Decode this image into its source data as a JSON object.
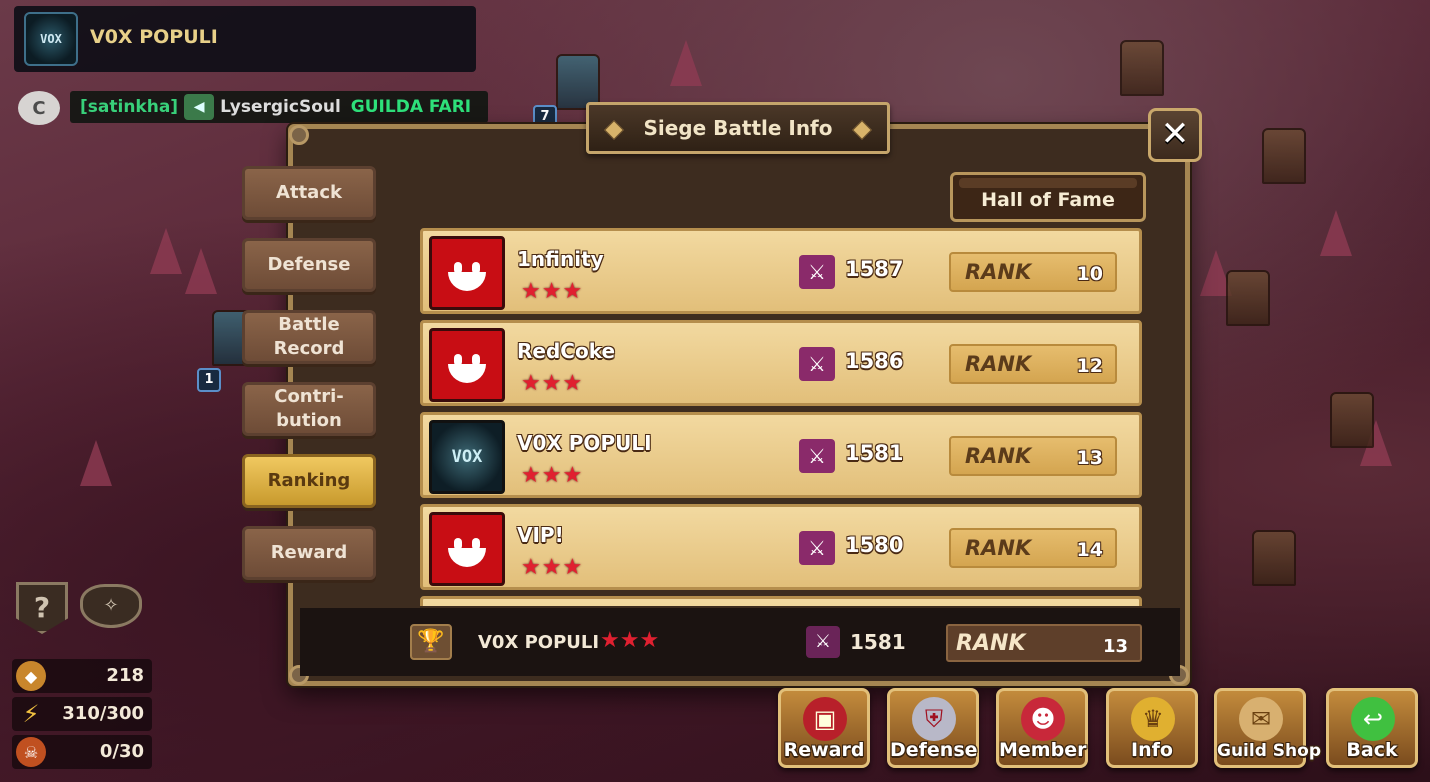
{
  "guild": {
    "name": "V0X POPULI",
    "emblem_text": "VOX"
  },
  "chat": {
    "channel": "C",
    "user": "[satinkha]",
    "name": "LysergicSoul",
    "message": "GUILDA FARI"
  },
  "map_markers": [
    "7",
    "1"
  ],
  "resources": [
    {
      "icon": "guild-coin-icon",
      "value": "218"
    },
    {
      "icon": "energy-icon",
      "value": "310/300"
    },
    {
      "icon": "guild-points-icon",
      "value": "0/30"
    }
  ],
  "left_icons": {
    "help": "?"
  },
  "panel": {
    "title": "Siege Battle Info",
    "close": "✕",
    "hall_of_fame": "Hall of Fame",
    "tabs": [
      {
        "label": "Attack"
      },
      {
        "label": "Defense"
      },
      {
        "label": "Battle Record"
      },
      {
        "label": "Contri-bution"
      },
      {
        "label": "Ranking",
        "active": true
      },
      {
        "label": "Reward"
      }
    ],
    "rank_word": "RANK",
    "rows": [
      {
        "name": "1nfinity",
        "stars": "★★★",
        "score": "1587",
        "rank": "10",
        "avatar": "smile"
      },
      {
        "name": "RedCoke",
        "stars": "★★★",
        "score": "1586",
        "rank": "12",
        "avatar": "smile"
      },
      {
        "name": "V0X POPULI",
        "stars": "★★★",
        "score": "1581",
        "rank": "13",
        "avatar": "vox"
      },
      {
        "name": "VIP!",
        "stars": "★★★",
        "score": "1580",
        "rank": "14",
        "avatar": "smile"
      }
    ],
    "footer": {
      "name": "V0X POPULI",
      "stars": "★★★",
      "score": "1581",
      "rank": "13"
    }
  },
  "bottom_buttons": [
    {
      "label": "Reward",
      "icon": "chest-icon",
      "glyph": "▣",
      "color": "#b8202a"
    },
    {
      "label": "Defense",
      "icon": "shield-icon",
      "glyph": "⛨",
      "color": "#b8b8c8"
    },
    {
      "label": "Member",
      "icon": "member-icon",
      "glyph": "☻",
      "color": "#c8283a"
    },
    {
      "label": "Info",
      "icon": "trophy-icon",
      "glyph": "♛",
      "color": "#e0b030"
    },
    {
      "label": "Guild Shop",
      "icon": "shop-icon",
      "glyph": "✉",
      "color": "#d8b070"
    },
    {
      "label": "Back",
      "icon": "back-arrow-icon",
      "glyph": "↩",
      "color": "#40c040"
    }
  ]
}
